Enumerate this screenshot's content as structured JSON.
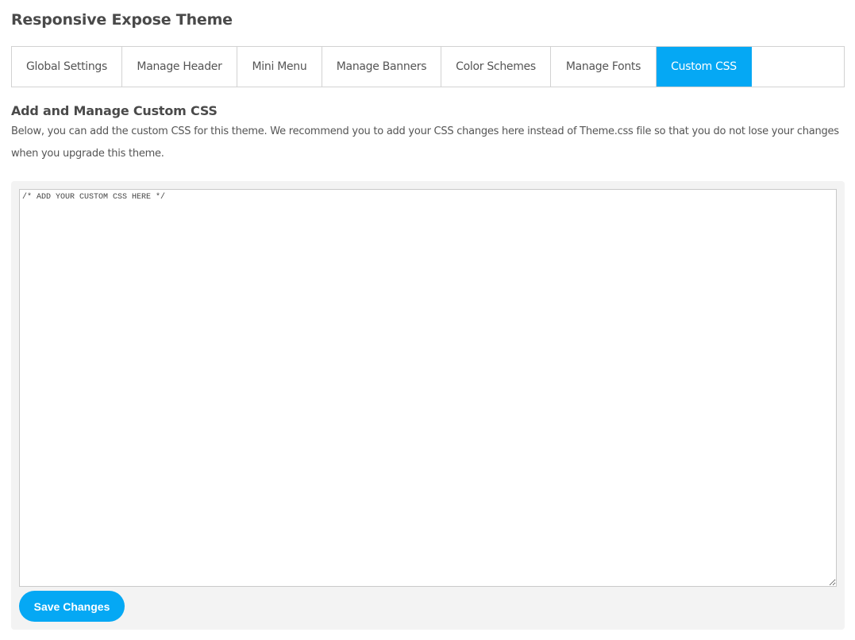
{
  "header": {
    "title": "Responsive Expose Theme"
  },
  "tabs": [
    {
      "label": "Global Settings",
      "active": false
    },
    {
      "label": "Manage Header",
      "active": false
    },
    {
      "label": "Mini Menu",
      "active": false
    },
    {
      "label": "Manage Banners",
      "active": false
    },
    {
      "label": "Color Schemes",
      "active": false
    },
    {
      "label": "Manage Fonts",
      "active": false
    },
    {
      "label": "Custom CSS",
      "active": true
    }
  ],
  "section": {
    "title": "Add and Manage Custom CSS",
    "description": "Below, you can add the custom CSS for this theme. We recommend you to add your CSS changes here instead of Theme.css file so that you do not lose your changes when you upgrade this theme."
  },
  "editor": {
    "value": "/* ADD YOUR CUSTOM CSS HERE */"
  },
  "actions": {
    "save_label": "Save Changes"
  },
  "colors": {
    "accent": "#05a8f4",
    "panel_bg": "#f3f3f3",
    "border": "#d2d2d2"
  }
}
